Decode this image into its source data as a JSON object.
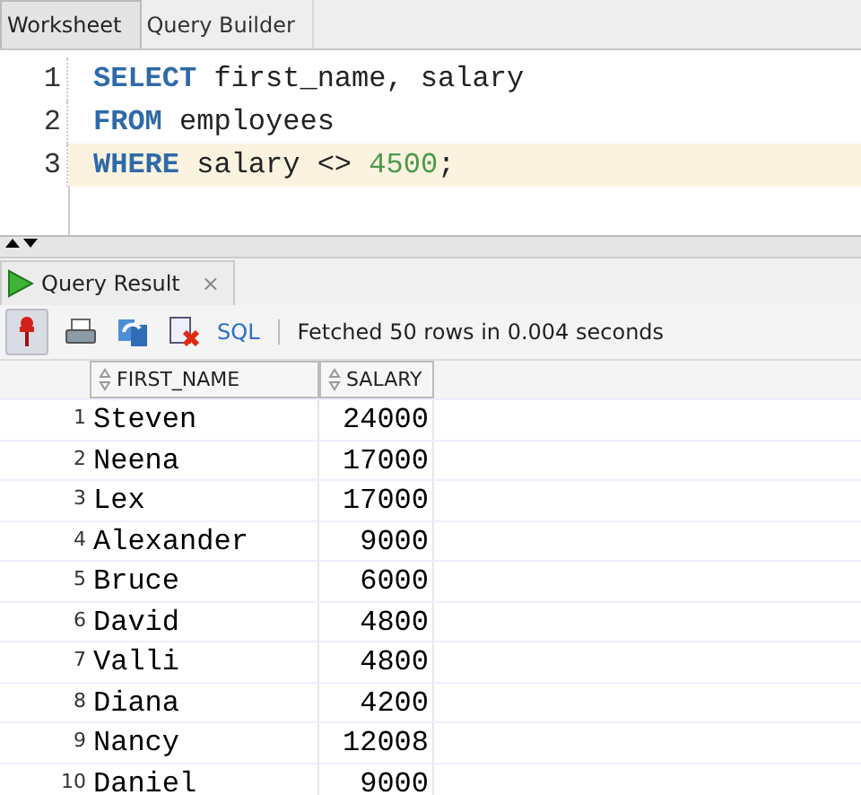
{
  "editor_tabs": [
    {
      "label": "Worksheet",
      "selected": true
    },
    {
      "label": "Query Builder",
      "selected": false
    }
  ],
  "editor": {
    "lines": [
      {
        "number": "1",
        "current": false,
        "tokens": [
          {
            "kind": "keyword",
            "text": "SELECT"
          },
          {
            "kind": "plain",
            "text": " first_name, salary"
          }
        ]
      },
      {
        "number": "2",
        "current": false,
        "tokens": [
          {
            "kind": "keyword",
            "text": "FROM"
          },
          {
            "kind": "plain",
            "text": " employees"
          }
        ]
      },
      {
        "number": "3",
        "current": true,
        "tokens": [
          {
            "kind": "keyword",
            "text": "WHERE"
          },
          {
            "kind": "plain",
            "text": " salary <> "
          },
          {
            "kind": "number",
            "text": "4500"
          },
          {
            "kind": "plain",
            "text": ";"
          }
        ]
      }
    ]
  },
  "result_tab": {
    "label": "Query Result",
    "close": "×"
  },
  "toolbar": {
    "sql_label": "SQL",
    "status": "Fetched 50 rows in 0.004 seconds"
  },
  "table": {
    "columns": [
      "FIRST_NAME",
      "SALARY"
    ],
    "rows": [
      {
        "number": "1",
        "first_name": "Steven",
        "salary": "24000"
      },
      {
        "number": "2",
        "first_name": "Neena",
        "salary": "17000"
      },
      {
        "number": "3",
        "first_name": "Lex",
        "salary": "17000"
      },
      {
        "number": "4",
        "first_name": "Alexander",
        "salary": "9000"
      },
      {
        "number": "5",
        "first_name": "Bruce",
        "salary": "6000"
      },
      {
        "number": "6",
        "first_name": "David",
        "salary": "4800"
      },
      {
        "number": "7",
        "first_name": "Valli",
        "salary": "4800"
      },
      {
        "number": "8",
        "first_name": "Diana",
        "salary": "4200"
      },
      {
        "number": "9",
        "first_name": "Nancy",
        "salary": "12008"
      },
      {
        "number": "10",
        "first_name": "Daniel",
        "salary": "9000"
      }
    ]
  }
}
